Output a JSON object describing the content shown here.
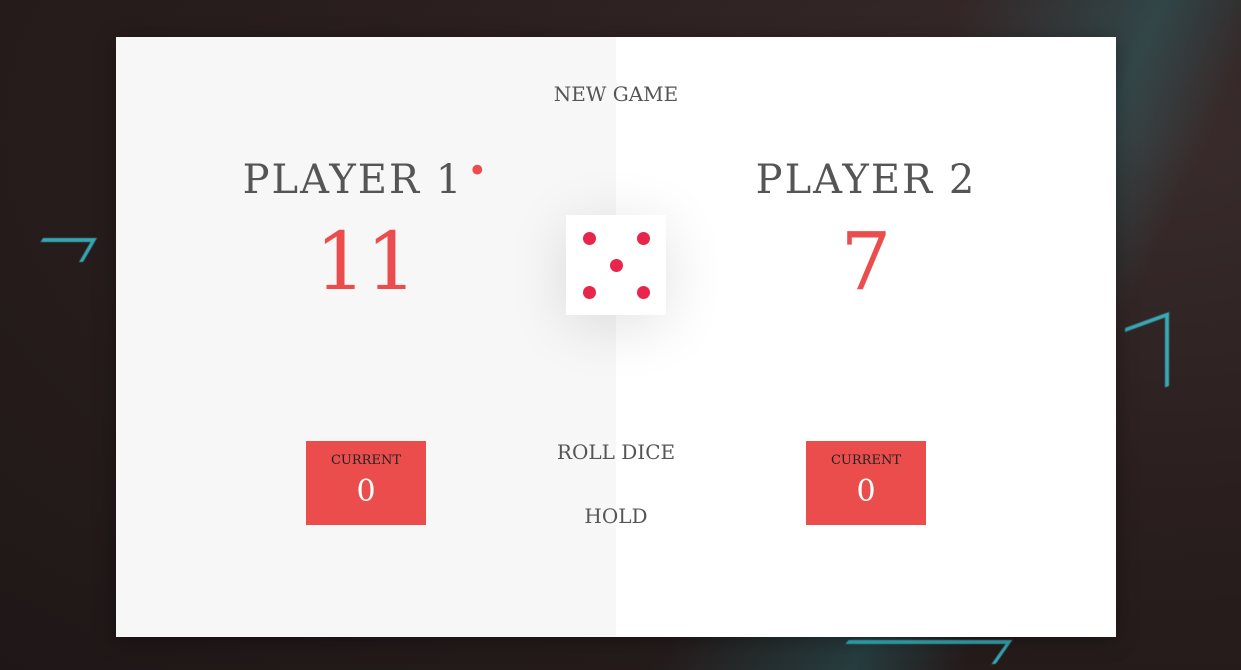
{
  "buttons": {
    "new_game": "NEW GAME",
    "roll_dice": "ROLL DICE",
    "hold": "HOLD"
  },
  "players": [
    {
      "name": "PLAYER 1",
      "score": "11",
      "current_label": "CURRENT",
      "current_score": "0",
      "active": true
    },
    {
      "name": "PLAYER 2",
      "score": "7",
      "current_label": "CURRENT",
      "current_score": "0",
      "active": false
    }
  ],
  "dice": {
    "value": 5
  },
  "active_indicator": "•",
  "colors": {
    "accent": "#eb4d4d",
    "pip": "#e8254a",
    "panel_active": "#f7f7f7",
    "panel_inactive": "#ffffff",
    "text": "#555555"
  }
}
